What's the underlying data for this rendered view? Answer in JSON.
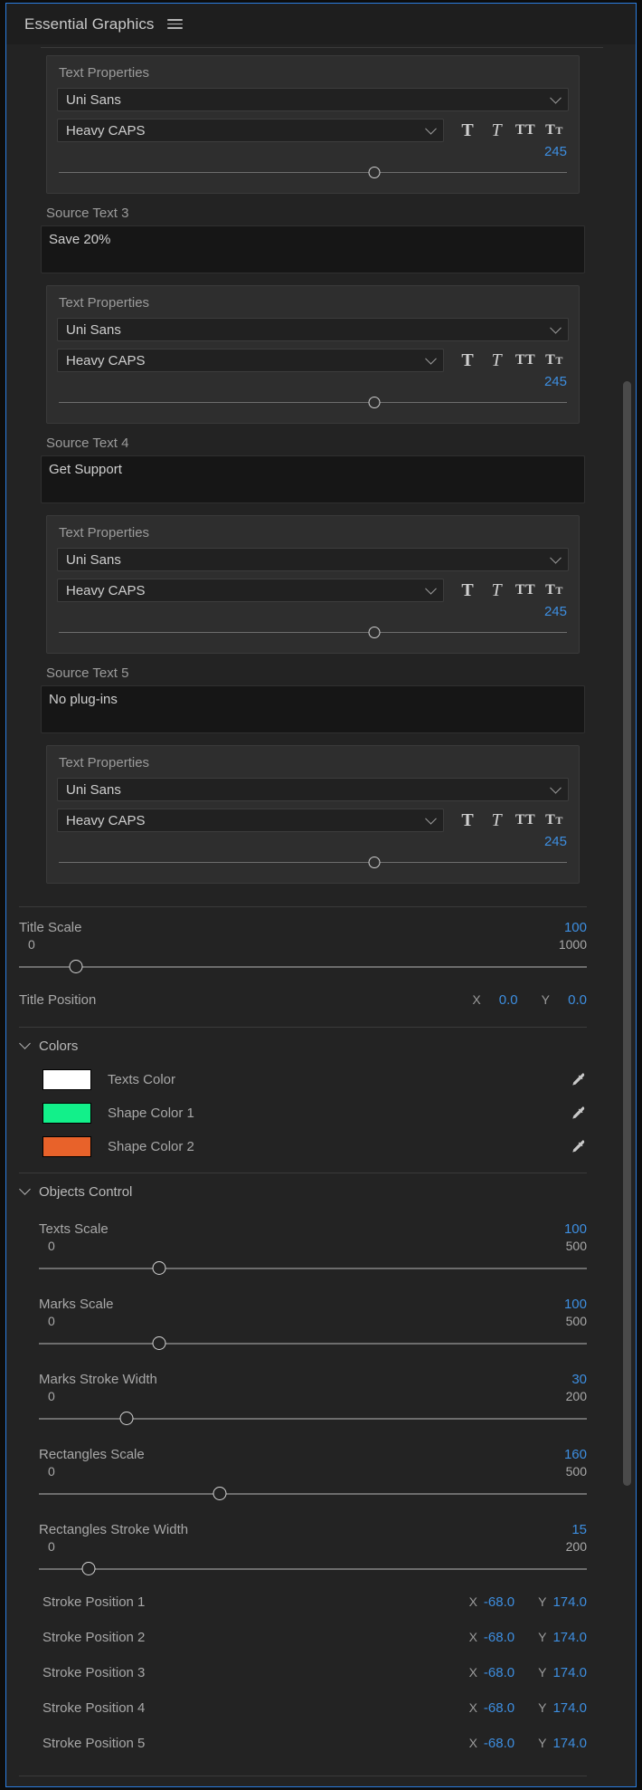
{
  "panel": {
    "title": "Essential Graphics",
    "menu_icon": "hamburger-menu-icon"
  },
  "text_groups": [
    {
      "card_title": "Text Properties",
      "font_family": "Uni Sans",
      "font_style": "Heavy CAPS",
      "style_buttons": [
        "T",
        "T",
        "TT",
        "TT"
      ],
      "font_size": "245",
      "slider_pct": 62
    },
    {
      "source_label": "Source Text 3",
      "source_value": "Save 20%",
      "card_title": "Text Properties",
      "font_family": "Uni Sans",
      "font_style": "Heavy CAPS",
      "font_size": "245",
      "slider_pct": 62
    },
    {
      "source_label": "Source Text 4",
      "source_value": "Get Support",
      "card_title": "Text Properties",
      "font_family": "Uni Sans",
      "font_style": "Heavy CAPS",
      "font_size": "245",
      "slider_pct": 62
    },
    {
      "source_label": "Source Text 5",
      "source_value": "No plug-ins",
      "card_title": "Text Properties",
      "font_family": "Uni Sans",
      "font_style": "Heavy CAPS",
      "font_size": "245",
      "slider_pct": 62
    }
  ],
  "title_scale": {
    "name": "Title Scale",
    "value": "100",
    "min": "0",
    "max": "1000",
    "knob_pct": 10
  },
  "title_position": {
    "name": "Title Position",
    "x_axis": "X",
    "x_value": "0.0",
    "y_axis": "Y",
    "y_value": "0.0"
  },
  "colors_section": {
    "title": "Colors",
    "rows": [
      {
        "name": "Texts Color",
        "hex": "#FFFFFF",
        "eyedropper": "eyedropper-icon"
      },
      {
        "name": "Shape Color 1",
        "hex": "#12F08A",
        "eyedropper": "eyedropper-icon"
      },
      {
        "name": "Shape Color 2",
        "hex": "#E8622A",
        "eyedropper": "eyedropper-icon"
      }
    ]
  },
  "objects_control": {
    "title": "Objects Control",
    "sliders": [
      {
        "name": "Texts Scale",
        "value": "100",
        "min": "0",
        "max": "500",
        "knob_pct": 22
      },
      {
        "name": "Marks Scale",
        "value": "100",
        "min": "0",
        "max": "500",
        "knob_pct": 22
      },
      {
        "name": "Marks Stroke Width",
        "value": "30",
        "min": "0",
        "max": "200",
        "knob_pct": 16
      },
      {
        "name": "Rectangles Scale",
        "value": "160",
        "min": "0",
        "max": "500",
        "knob_pct": 33
      },
      {
        "name": "Rectangles Stroke Width",
        "value": "15",
        "min": "0",
        "max": "200",
        "knob_pct": 9
      }
    ],
    "stroke_positions": [
      {
        "name": "Stroke Position 1",
        "x_axis": "X",
        "x_value": "-68.0",
        "y_axis": "Y",
        "y_value": "174.0"
      },
      {
        "name": "Stroke Position 2",
        "x_axis": "X",
        "x_value": "-68.0",
        "y_axis": "Y",
        "y_value": "174.0"
      },
      {
        "name": "Stroke Position 3",
        "x_axis": "X",
        "x_value": "-68.0",
        "y_axis": "Y",
        "y_value": "174.0"
      },
      {
        "name": "Stroke Position 4",
        "x_axis": "X",
        "x_value": "-68.0",
        "y_axis": "Y",
        "y_value": "174.0"
      },
      {
        "name": "Stroke Position 5",
        "x_axis": "X",
        "x_value": "-68.0",
        "y_axis": "Y",
        "y_value": "174.0"
      }
    ]
  },
  "theme": {
    "accent_blue": "#3d8ee0",
    "panel_bg": "#232323",
    "card_bg": "#2e2e2e",
    "field_bg": "#161616",
    "focus_border": "#2b7de0"
  }
}
